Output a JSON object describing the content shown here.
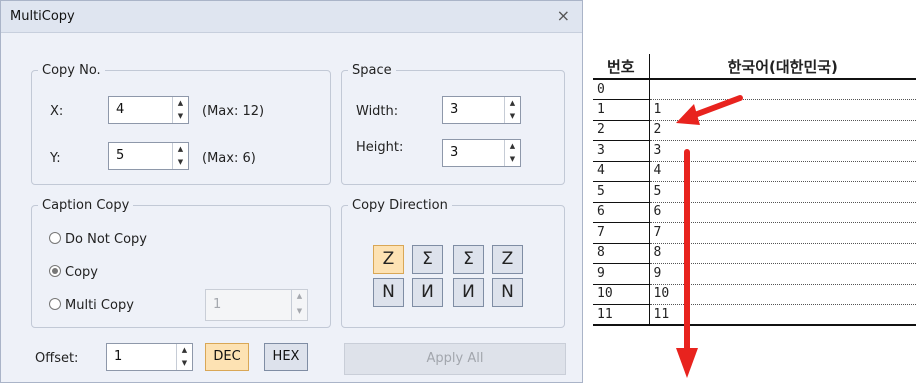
{
  "dialog": {
    "title": "MultiCopy",
    "close_glyph": "×",
    "copy_no": {
      "legend": "Copy No.",
      "x_label": "X:",
      "x_value": "4",
      "x_max": "(Max: 12)",
      "y_label": "Y:",
      "y_value": "5",
      "y_max": "(Max: 6)"
    },
    "space": {
      "legend": "Space",
      "width_label": "Width:",
      "width_value": "3",
      "height_label": "Height:",
      "height_value": "3"
    },
    "caption_copy": {
      "legend": "Caption Copy",
      "options": [
        "Do Not Copy",
        "Copy",
        "Multi Copy"
      ],
      "selected": "Copy",
      "multi_copy_value": "1"
    },
    "copy_direction": {
      "legend": "Copy Direction",
      "top_row": [
        "Z",
        "Σ",
        "Σ",
        "Z"
      ],
      "bottom_row": [
        "N",
        "И",
        "И",
        "N"
      ],
      "active_index": 0
    },
    "offset": {
      "label": "Offset:",
      "value": "1",
      "dec_label": "DEC",
      "hex_label": "HEX",
      "active": "DEC"
    },
    "apply_all_label": "Apply All"
  },
  "spreadsheet": {
    "headers": [
      "번호",
      "한국어(대한민국)"
    ],
    "rows": [
      [
        "0",
        ""
      ],
      [
        "1",
        "1"
      ],
      [
        "2",
        "2"
      ],
      [
        "3",
        "3"
      ],
      [
        "4",
        "4"
      ],
      [
        "5",
        "5"
      ],
      [
        "6",
        "6"
      ],
      [
        "7",
        "7"
      ],
      [
        "8",
        "8"
      ],
      [
        "9",
        "9"
      ],
      [
        "10",
        "10"
      ],
      [
        "11",
        "11"
      ]
    ],
    "annotation_color": "#e8231e"
  },
  "colors": {
    "dialog_bg": "#eef1f8",
    "titlebar_bg": "#dfe5f0",
    "active_button_bg": "#fde2b3",
    "arrow_red": "#e8231e"
  }
}
